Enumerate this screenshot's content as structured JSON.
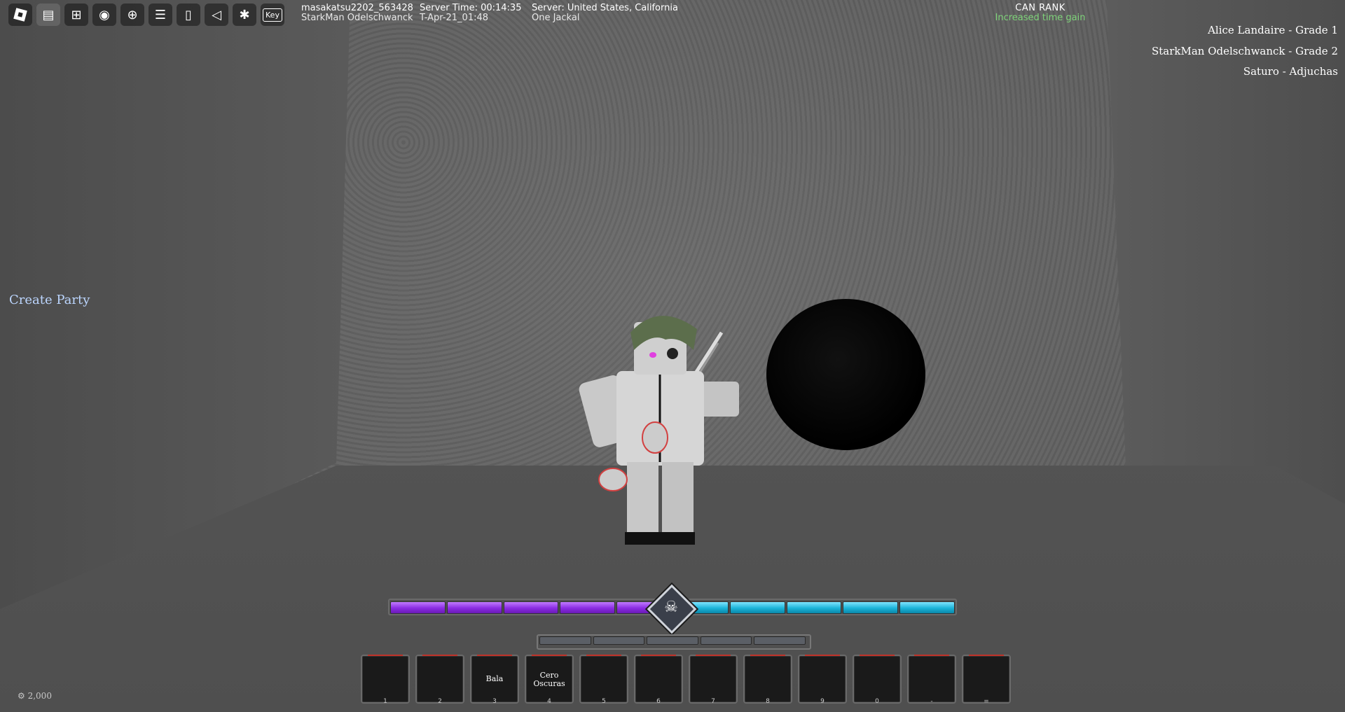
{
  "toolbar": {
    "items": [
      "roblox-menu",
      "chat",
      "gift",
      "screenshot",
      "record",
      "leaderboard",
      "door",
      "sound",
      "dance",
      "key"
    ],
    "key_label": "Key"
  },
  "player": {
    "username": "masakatsu2202_563428",
    "character": "StarkMan Odelschwanck"
  },
  "server_time": {
    "label": "Server Time: 00:14:35",
    "date": "T-Apr-21_01:48"
  },
  "server": {
    "region": "Server: United States, California",
    "title": "One Jackal"
  },
  "rank": {
    "title": "CAN RANK",
    "status": "Increased time gain"
  },
  "player_list": [
    "Alice Landaire - Grade 1",
    "StarkMan Odelschwanck - Grade 2",
    "Saturo  - Adjuchas"
  ],
  "create_party": "Create Party",
  "energy_bar": {
    "purple_segments": 5,
    "cyan_segments": 5,
    "purple_color": "#8a2be2",
    "cyan_color": "#1ab3d8"
  },
  "hotbar": [
    {
      "label": "",
      "key": "1"
    },
    {
      "label": "",
      "key": "2"
    },
    {
      "label": "Bala",
      "key": "3"
    },
    {
      "label": "Cero Oscuras",
      "key": "4"
    },
    {
      "label": "",
      "key": "5"
    },
    {
      "label": "",
      "key": "6"
    },
    {
      "label": "",
      "key": "7"
    },
    {
      "label": "",
      "key": "8"
    },
    {
      "label": "",
      "key": "9"
    },
    {
      "label": "",
      "key": "0"
    },
    {
      "label": "",
      "key": "-"
    },
    {
      "label": "",
      "key": "="
    }
  ],
  "currency": "2,000"
}
